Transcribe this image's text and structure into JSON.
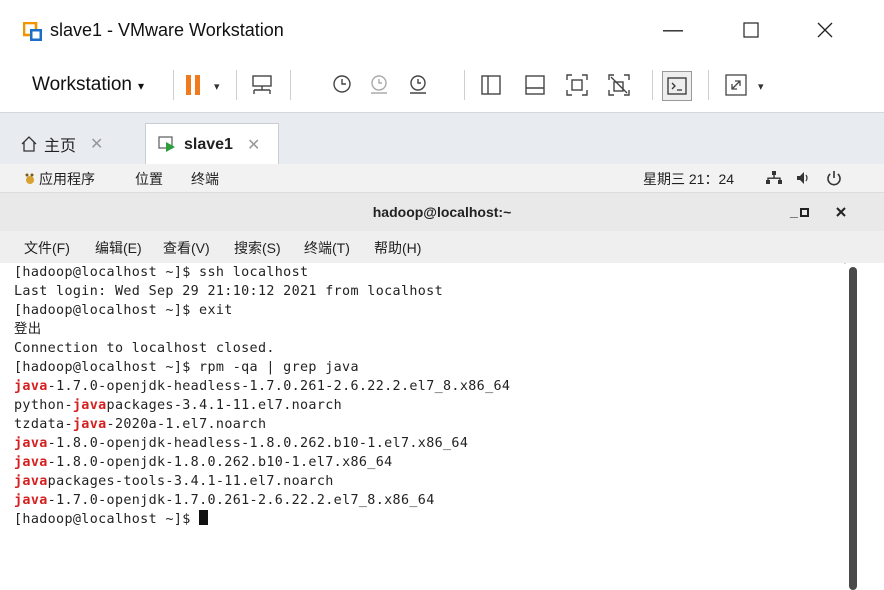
{
  "window": {
    "title": "slave1 - VMware Workstation",
    "minimize_glyph": "—",
    "maximize_glyph": "☐",
    "close_glyph": "✕"
  },
  "toolbar": {
    "workstation_label": "Workstation",
    "caret": "▾"
  },
  "tabs": [
    {
      "label": "主页",
      "icon": "home-icon",
      "active": false
    },
    {
      "label": "slave1",
      "icon": "vm-icon",
      "active": true
    }
  ],
  "tab_close_glyph": "✕",
  "gnome": {
    "apps": "应用程序",
    "places": "位置",
    "terminal": "终端",
    "clock": "星期三 21：24"
  },
  "terminal": {
    "title": "hadoop@localhost:~",
    "menu": [
      "文件(F)",
      "编辑(E)",
      "查看(V)",
      "搜索(S)",
      "终端(T)",
      "帮助(H)"
    ],
    "lines": [
      {
        "segments": [
          {
            "text": "[hadoop@localhost ~]$ ssh localhost",
            "hl": false
          }
        ]
      },
      {
        "segments": [
          {
            "text": "Last login: Wed Sep 29 21:10:12 2021 from localhost",
            "hl": false
          }
        ]
      },
      {
        "segments": [
          {
            "text": "[hadoop@localhost ~]$ exit",
            "hl": false
          }
        ]
      },
      {
        "segments": [
          {
            "text": "登出",
            "hl": false
          }
        ]
      },
      {
        "segments": [
          {
            "text": "Connection to localhost closed.",
            "hl": false
          }
        ]
      },
      {
        "segments": [
          {
            "text": "[hadoop@localhost ~]$ rpm -qa | grep java",
            "hl": false
          }
        ]
      },
      {
        "segments": [
          {
            "text": "java",
            "hl": true
          },
          {
            "text": "-1.7.0-openjdk-headless-1.7.0.261-2.6.22.2.el7_8.x86_64",
            "hl": false
          }
        ]
      },
      {
        "segments": [
          {
            "text": "python-",
            "hl": false
          },
          {
            "text": "java",
            "hl": true
          },
          {
            "text": "packages-3.4.1-11.el7.noarch",
            "hl": false
          }
        ]
      },
      {
        "segments": [
          {
            "text": "tzdata-",
            "hl": false
          },
          {
            "text": "java",
            "hl": true
          },
          {
            "text": "-2020a-1.el7.noarch",
            "hl": false
          }
        ]
      },
      {
        "segments": [
          {
            "text": "java",
            "hl": true
          },
          {
            "text": "-1.8.0-openjdk-headless-1.8.0.262.b10-1.el7.x86_64",
            "hl": false
          }
        ]
      },
      {
        "segments": [
          {
            "text": "java",
            "hl": true
          },
          {
            "text": "-1.8.0-openjdk-1.8.0.262.b10-1.el7.x86_64",
            "hl": false
          }
        ]
      },
      {
        "segments": [
          {
            "text": "java",
            "hl": true
          },
          {
            "text": "packages-tools-3.4.1-11.el7.noarch",
            "hl": false
          }
        ]
      },
      {
        "segments": [
          {
            "text": "java",
            "hl": true
          },
          {
            "text": "-1.7.0-openjdk-1.7.0.261-2.6.22.2.el7_8.x86_64",
            "hl": false
          }
        ]
      },
      {
        "segments": [
          {
            "text": "[hadoop@localhost ~]$ ",
            "hl": false
          }
        ],
        "cursor": true
      }
    ]
  },
  "colors": {
    "highlight": "#d42020",
    "pause_orange": "#f07b1f",
    "vm_logo_orange": "#f29400",
    "vm_logo_blue": "#1c6fc9"
  }
}
